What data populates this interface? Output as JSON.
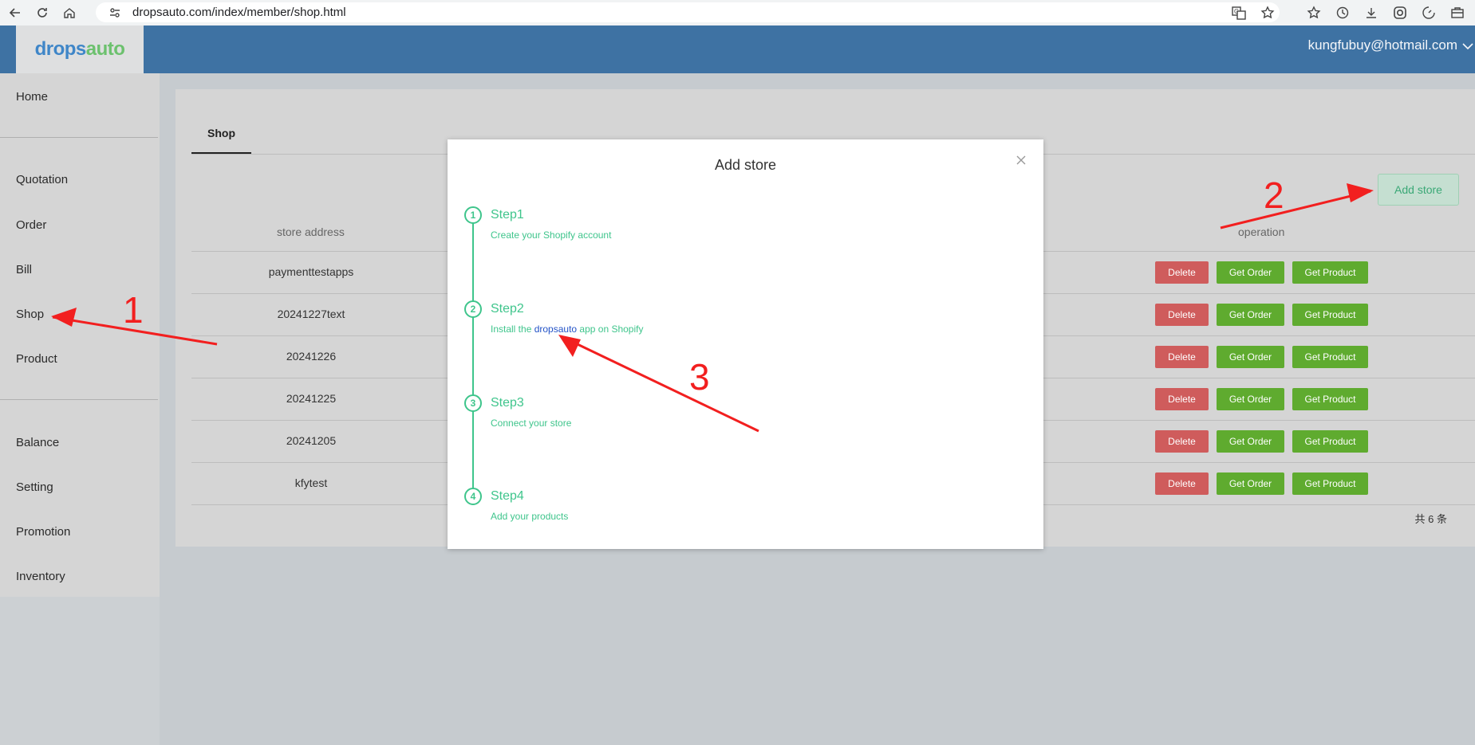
{
  "browser": {
    "url": "dropsauto.com/index/member/shop.html"
  },
  "header": {
    "logo_part1": "drops",
    "logo_part2": "auto",
    "user_email": "kungfubuy@hotmail.com"
  },
  "sidebar": {
    "items": [
      {
        "label": "Home"
      },
      {
        "label": "Quotation"
      },
      {
        "label": "Order"
      },
      {
        "label": "Bill"
      },
      {
        "label": "Shop"
      },
      {
        "label": "Product"
      },
      {
        "label": "Balance"
      },
      {
        "label": "Setting"
      },
      {
        "label": "Promotion"
      },
      {
        "label": "Inventory"
      }
    ]
  },
  "main": {
    "tab_label": "Shop",
    "add_store_label": "Add store",
    "columns": {
      "store_address": "store address",
      "operation": "operation"
    },
    "rows": [
      {
        "address": "paymenttestapps"
      },
      {
        "address": "20241227text"
      },
      {
        "address": "20241226"
      },
      {
        "address": "20241225"
      },
      {
        "address": "20241205"
      },
      {
        "address": "kfytest"
      }
    ],
    "actions": {
      "delete": "Delete",
      "get_order": "Get Order",
      "get_product": "Get Product"
    },
    "total": "共 6 条"
  },
  "modal": {
    "title": "Add store",
    "steps": [
      {
        "num": "1",
        "title": "Step1",
        "desc": "Create your Shopify account"
      },
      {
        "num": "2",
        "title": "Step2",
        "desc_pre": "Install the ",
        "desc_link": "dropsauto",
        "desc_post": " app on Shopify"
      },
      {
        "num": "3",
        "title": "Step3",
        "desc": "Connect your store"
      },
      {
        "num": "4",
        "title": "Step4",
        "desc": "Add your products"
      }
    ]
  },
  "annotations": {
    "label_1": "1",
    "label_2": "2",
    "label_3": "3"
  },
  "colors": {
    "header_blue": "#3e72a3",
    "step_green": "#3fc58c",
    "delete_red": "#cf5c5c",
    "action_green": "#5fab2f",
    "annotation_red": "#f21f1f"
  }
}
